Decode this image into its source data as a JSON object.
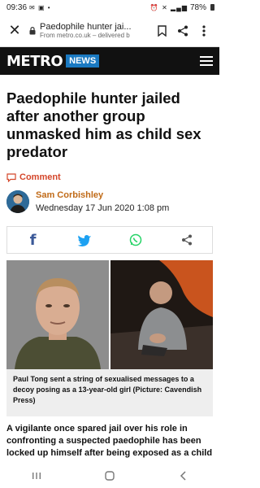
{
  "status_bar": {
    "time": "09:36",
    "battery": "78%"
  },
  "browser": {
    "title": "Paedophile hunter jai...",
    "subtitle": "From metro.co.uk – delivered b"
  },
  "site": {
    "logo": "METRO",
    "section": "NEWS"
  },
  "article": {
    "headline": "Paedophile hunter jailed after another group unmasked him as child sex predator",
    "comment_label": "Comment",
    "author": "Sam Corbishley",
    "date": "Wednesday 17 Jun 2020 1:08 pm",
    "caption": "Paul Tong sent a string of sexualised messages to a decoy posing as a 13-year-old girl (Picture: Cavendish Press)",
    "body": "A vigilante once spared jail over his role in confronting a suspected paedophile has been locked up himself after being exposed as a child"
  },
  "colors": {
    "accent": "#d4462a",
    "author": "#c06a17",
    "news_badge": "#1a79c1",
    "facebook": "#3b5998",
    "twitter": "#1da1f2",
    "whatsapp": "#25d366"
  },
  "icons": [
    "close-icon",
    "lock-icon",
    "bookmark-icon",
    "share-icon",
    "more-vert-icon",
    "menu-icon",
    "comment-icon",
    "facebook-icon",
    "twitter-icon",
    "whatsapp-icon",
    "share-alt-icon",
    "recent-apps-icon",
    "home-icon",
    "back-icon"
  ]
}
